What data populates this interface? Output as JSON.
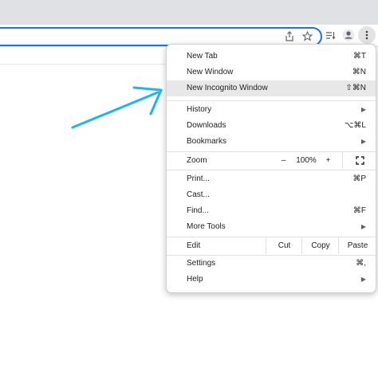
{
  "toolbar": {
    "share_icon": "share-icon",
    "star_icon": "star-icon",
    "reading_list_icon": "reading-list-icon",
    "profile_icon": "profile-icon",
    "menu_icon": "more-vert-icon"
  },
  "menu": {
    "items_top": [
      {
        "label": "New Tab",
        "shortcut": "⌘T"
      },
      {
        "label": "New Window",
        "shortcut": "⌘N"
      },
      {
        "label": "New Incognito Window",
        "shortcut": "⇧⌘N"
      }
    ],
    "items_history": [
      {
        "label": "History",
        "arrow": "▶"
      },
      {
        "label": "Downloads",
        "shortcut": "⌥⌘L"
      },
      {
        "label": "Bookmarks",
        "arrow": "▶"
      }
    ],
    "zoom": {
      "label": "Zoom",
      "minus": "–",
      "value": "100%",
      "plus": "+",
      "fullscreen": "⛶"
    },
    "items_tools": [
      {
        "label": "Print...",
        "shortcut": "⌘P"
      },
      {
        "label": "Cast..."
      },
      {
        "label": "Find...",
        "shortcut": "⌘F"
      },
      {
        "label": "More Tools",
        "arrow": "▶"
      }
    ],
    "edit": {
      "label": "Edit",
      "cut": "Cut",
      "copy": "Copy",
      "paste": "Paste"
    },
    "items_bottom": [
      {
        "label": "Settings",
        "shortcut": "⌘,"
      },
      {
        "label": "Help",
        "arrow": "▶"
      }
    ]
  },
  "colors": {
    "annotation_arrow": "#1ab8e8",
    "omnibox_focus": "#1a73e8"
  }
}
